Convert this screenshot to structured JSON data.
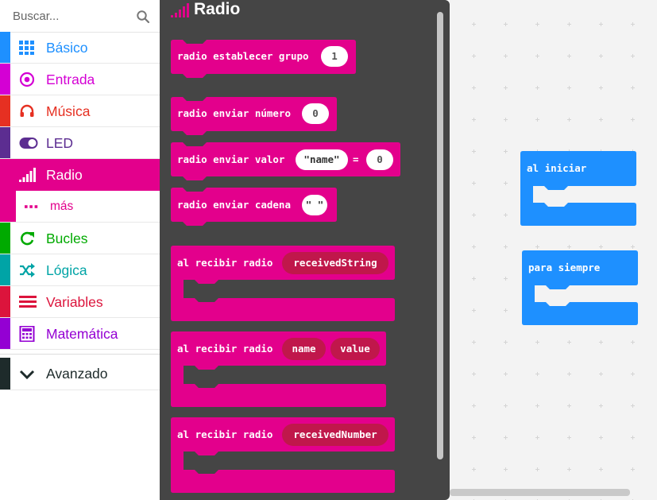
{
  "search": {
    "placeholder": "Buscar..."
  },
  "categories": [
    {
      "key": "basico",
      "label": "Básico",
      "color": "#1e90ff",
      "icon": "grid-icon"
    },
    {
      "key": "entrada",
      "label": "Entrada",
      "color": "#d400d4",
      "icon": "target-icon"
    },
    {
      "key": "musica",
      "label": "Música",
      "color": "#e63022",
      "icon": "headphones-icon"
    },
    {
      "key": "led",
      "label": "LED",
      "color": "#5c2d91",
      "icon": "toggle-icon"
    },
    {
      "key": "radio",
      "label": "Radio",
      "color": "#e3008c",
      "icon": "signal-bars-icon",
      "selected": true
    },
    {
      "key": "mas",
      "label": "más",
      "color": "#e3008c",
      "icon": "ellipsis-icon"
    },
    {
      "key": "bucles",
      "label": "Bucles",
      "color": "#00aa00",
      "icon": "refresh-icon"
    },
    {
      "key": "logica",
      "label": "Lógica",
      "color": "#00a4a6",
      "icon": "shuffle-icon"
    },
    {
      "key": "variables",
      "label": "Variables",
      "color": "#dc143c",
      "icon": "list-lines-icon"
    },
    {
      "key": "matematica",
      "label": "Matemática",
      "color": "#9400d3",
      "icon": "calculator-icon"
    },
    {
      "key": "avanzado",
      "label": "Avanzado",
      "color": "#1e2b2b",
      "icon": "chevron-down-icon"
    }
  ],
  "flyout": {
    "title": "Radio",
    "color": "#e3008c",
    "blocks": {
      "set_group": {
        "text": "radio establecer grupo",
        "value": "1"
      },
      "send_number": {
        "text": "radio enviar número",
        "value": "0"
      },
      "send_value": {
        "text": "radio enviar valor",
        "name": "\"name\"",
        "equals": "=",
        "value": "0"
      },
      "send_string": {
        "text": "radio enviar cadena",
        "value": "\" \""
      },
      "recv_string": {
        "text": "al recibir radio",
        "var": "receivedString"
      },
      "recv_value": {
        "text": "al recibir radio",
        "var1": "name",
        "var2": "value"
      },
      "recv_number": {
        "text": "al recibir radio",
        "var": "receivedNumber"
      }
    }
  },
  "workspace": {
    "on_start": "al iniciar",
    "forever": "para siempre",
    "block_color": "#1e90ff"
  }
}
